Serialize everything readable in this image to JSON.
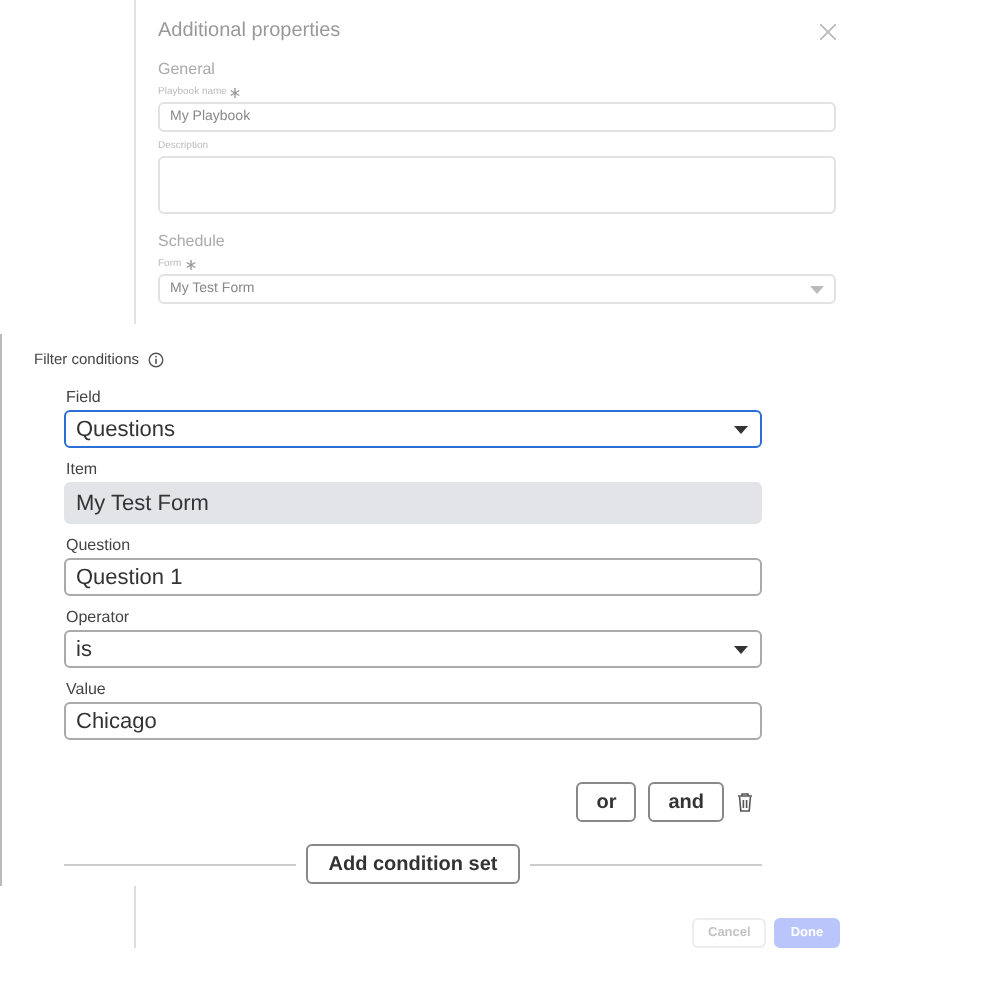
{
  "properties_panel": {
    "title": "Additional properties",
    "sections": [
      {
        "heading": "General",
        "fields": [
          {
            "kind": "input",
            "label": "Playbook name",
            "required": true,
            "value": "My Playbook"
          },
          {
            "kind": "textarea",
            "label": "Description",
            "required": false
          }
        ]
      },
      {
        "heading": "Schedule",
        "fields": [
          {
            "kind": "select",
            "label": "Form",
            "required": true,
            "value": "My Test Form"
          }
        ]
      }
    ]
  },
  "filter_conditions": {
    "title": "Filter conditions",
    "fields": [
      {
        "kind": "select",
        "label": "Field",
        "value": "Questions",
        "focused": true,
        "disabled": false
      },
      {
        "kind": "input",
        "label": "Item",
        "value": "My Test Form",
        "focused": false,
        "disabled": true
      },
      {
        "kind": "input",
        "label": "Question",
        "value": "Question 1",
        "focused": false,
        "disabled": false
      },
      {
        "kind": "select",
        "label": "Operator",
        "value": "is",
        "focused": false,
        "disabled": false
      },
      {
        "kind": "input",
        "label": "Value",
        "value": "Chicago",
        "focused": false,
        "disabled": false
      }
    ],
    "logic_buttons": [
      "or",
      "and"
    ],
    "add_button": "Add condition set"
  },
  "footer_buttons": [
    {
      "label": "Cancel",
      "kind": "secondary",
      "disabled": true
    },
    {
      "label": "Done",
      "kind": "primary",
      "disabled": true
    }
  ]
}
